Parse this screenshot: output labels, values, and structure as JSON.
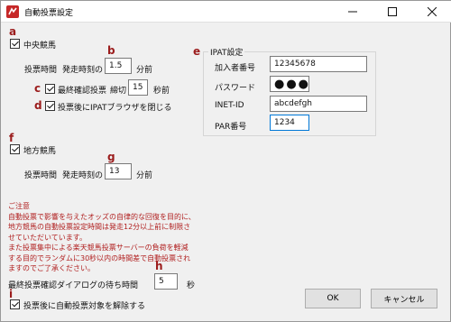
{
  "window": {
    "title": "自動投票設定",
    "minimize_icon": "minimize-icon",
    "maximize_icon": "maximize-icon",
    "close_icon": "close-icon"
  },
  "annotations": {
    "a": "a",
    "b": "b",
    "c": "c",
    "d": "d",
    "e": "e",
    "f": "f",
    "g": "g",
    "h": "h",
    "i": "i"
  },
  "jra": {
    "checkbox_label": "中央競馬",
    "checked": true,
    "vote_time_label": "投票時間",
    "before_start_label": "発走時刻の",
    "minutes_value": "1.5",
    "minutes_suffix": "分前",
    "final_confirm_label": "最終確認投票",
    "final_confirm_checked": true,
    "deadline_label": "締切",
    "seconds_value": "15",
    "seconds_suffix": "秒前",
    "close_browser_label": "投票後にIPATブラウザを閉じる",
    "close_browser_checked": true
  },
  "ipat": {
    "group_title": "IPAT設定",
    "subscriber_label": "加入者番号",
    "subscriber_value": "12345678",
    "password_label": "パスワード",
    "password_value": "●●●●",
    "inet_label": "INET-ID",
    "inet_value": "abcdefgh",
    "pars_label": "PAR番号",
    "pars_value": "1234"
  },
  "nar": {
    "checkbox_label": "地方競馬",
    "checked": true,
    "vote_time_label": "投票時間",
    "before_start_label": "発走時刻の",
    "minutes_value": "13",
    "minutes_suffix": "分前"
  },
  "notice": {
    "lines": [
      "ご注意",
      "自動投票で影響を与えたオッズの自律的な回復を目的に、",
      "地方競馬の自動投票設定時間は発走12分以上前に制限さ",
      "せていただいています。",
      "また投票集中による楽天競馬投票サーバーの負荷を軽減",
      "する目的でランダムに30秒以内の時間差で自動投票され",
      "ますのでご了承ください。"
    ]
  },
  "dialog_wait": {
    "label": "最終投票確認ダイアログの待ち時間",
    "value": "5",
    "suffix": "秒"
  },
  "release_after_vote": {
    "label": "投票後に自動投票対象を解除する",
    "checked": true
  },
  "buttons": {
    "ok": "OK",
    "cancel": "キャンセル"
  },
  "colors": {
    "annotation": "#9b1c1c",
    "notice_text": "#b01e1e",
    "focus_border": "#0078d7",
    "app_icon": "#c62828"
  }
}
